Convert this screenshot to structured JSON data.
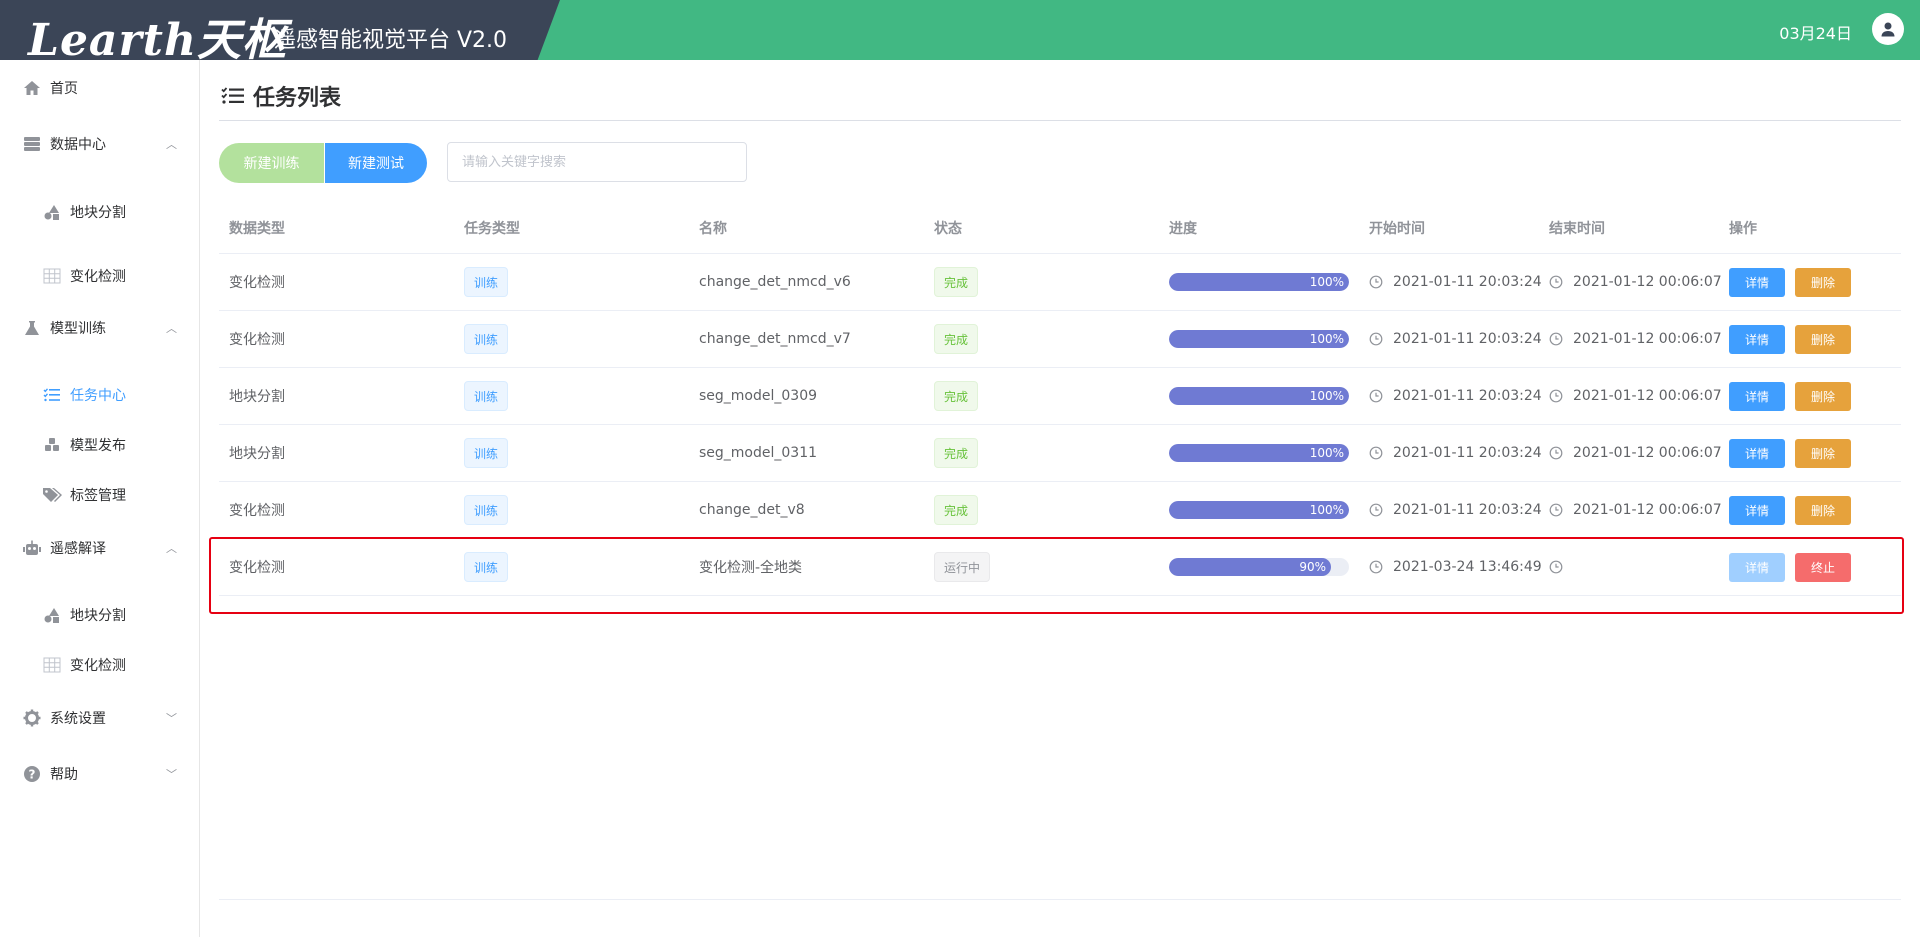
{
  "header": {
    "logo": "Learth天枢",
    "platform": "遥感智能视觉平台 V2.0",
    "date": "03月24日",
    "bg_color": "#41b883",
    "logo_bg_color": "#3b4557"
  },
  "sidebar": {
    "items": [
      {
        "label": "首页",
        "icon": "home-icon"
      },
      {
        "label": "数据中心",
        "icon": "database-icon"
      },
      {
        "label": "地块分割",
        "icon": "shapes-icon"
      },
      {
        "label": "变化检测",
        "icon": "grid-icon"
      },
      {
        "label": "模型训练",
        "icon": "flask-icon"
      },
      {
        "label": "任务中心",
        "icon": "tasks-icon"
      },
      {
        "label": "模型发布",
        "icon": "cubes-icon"
      },
      {
        "label": "标签管理",
        "icon": "tags-icon"
      },
      {
        "label": "遥感解译",
        "icon": "robot-icon"
      },
      {
        "label": "地块分割",
        "icon": "shapes-icon"
      },
      {
        "label": "变化检测",
        "icon": "grid-icon"
      },
      {
        "label": "系统设置",
        "icon": "gear-icon"
      },
      {
        "label": "帮助",
        "icon": "help-icon"
      }
    ],
    "active_color": "#409eff"
  },
  "main": {
    "title": "任务列表",
    "btn_train": "新建训练",
    "btn_test": "新建测试",
    "search_placeholder": "请输入关键字搜索"
  },
  "table": {
    "headers": [
      "数据类型",
      "任务类型",
      "名称",
      "状态",
      "进度",
      "开始时间",
      "结束时间",
      "操作"
    ],
    "rows": [
      {
        "data_type": "变化检测",
        "task_type": "训练",
        "name": "change_det_nmcd_v6",
        "status": "完成",
        "progress": 100,
        "progress_label": "100%",
        "start": "2021-01-11 20:03:24",
        "end": "2021-01-12 00:06:07",
        "btn1": "详情",
        "btn2": "删除"
      },
      {
        "data_type": "变化检测",
        "task_type": "训练",
        "name": "change_det_nmcd_v7",
        "status": "完成",
        "progress": 100,
        "progress_label": "100%",
        "start": "2021-01-11 20:03:24",
        "end": "2021-01-12 00:06:07",
        "btn1": "详情",
        "btn2": "删除"
      },
      {
        "data_type": "地块分割",
        "task_type": "训练",
        "name": "seg_model_0309",
        "status": "完成",
        "progress": 100,
        "progress_label": "100%",
        "start": "2021-01-11 20:03:24",
        "end": "2021-01-12 00:06:07",
        "btn1": "详情",
        "btn2": "删除"
      },
      {
        "data_type": "地块分割",
        "task_type": "训练",
        "name": "seg_model_0311",
        "status": "完成",
        "progress": 100,
        "progress_label": "100%",
        "start": "2021-01-11 20:03:24",
        "end": "2021-01-12 00:06:07",
        "btn1": "详情",
        "btn2": "删除"
      },
      {
        "data_type": "变化检测",
        "task_type": "训练",
        "name": "change_det_v8",
        "status": "完成",
        "progress": 100,
        "progress_label": "100%",
        "start": "2021-01-11 20:03:24",
        "end": "2021-01-12 00:06:07",
        "btn1": "详情",
        "btn2": "删除"
      },
      {
        "data_type": "变化检测",
        "task_type": "训练",
        "name": "变化检测-全地类",
        "status": "运行中",
        "progress": 90,
        "progress_label": "90%",
        "start": "2021-03-24 13:46:49",
        "end": "",
        "btn1": "详情",
        "btn2": "终止"
      }
    ]
  }
}
